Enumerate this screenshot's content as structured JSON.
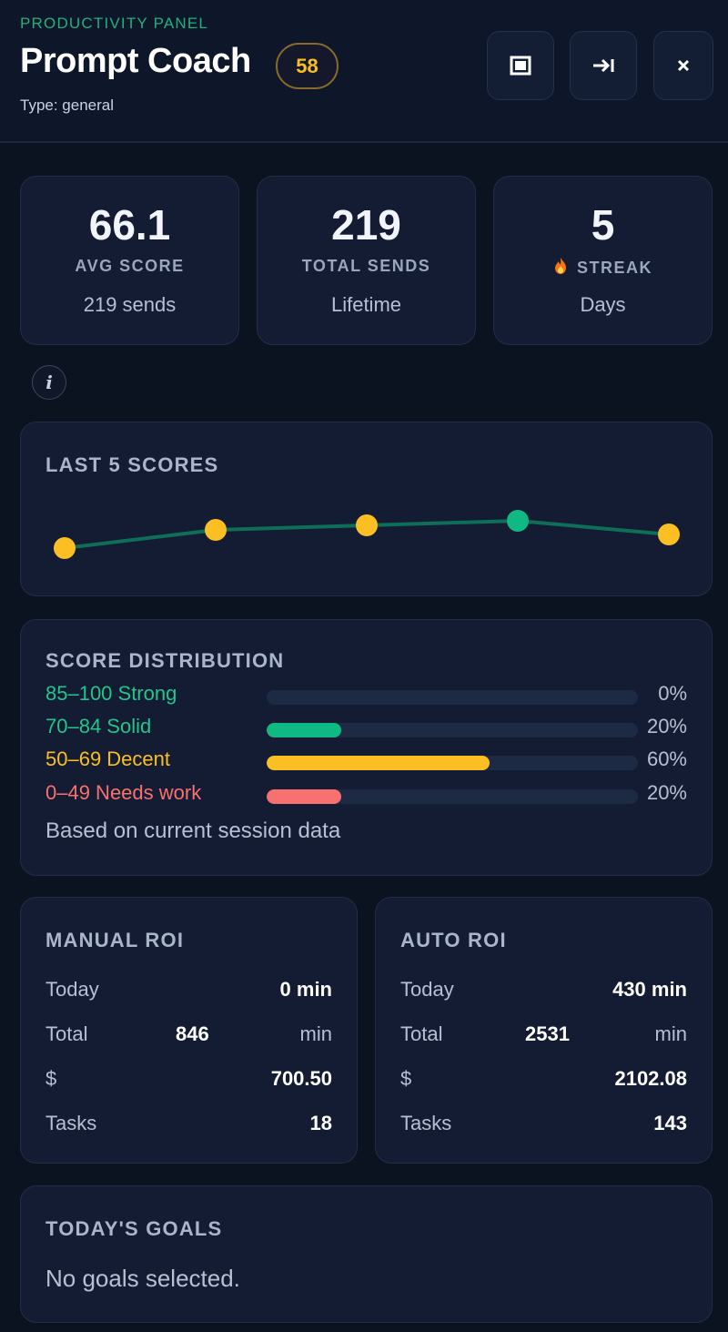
{
  "header": {
    "eyebrow": "PRODUCTIVITY PANEL",
    "title": "Prompt Coach",
    "badge": "58",
    "subtitle": "Type: general",
    "buttons": [
      {
        "icon": "square-icon",
        "glyph": "▣"
      },
      {
        "icon": "arrow-right-to-bar-icon",
        "glyph": "⇥"
      },
      {
        "icon": "close-icon",
        "glyph": "×"
      }
    ]
  },
  "stats": [
    {
      "value": "66.1",
      "label": "AVG SCORE",
      "sub": "219 sends"
    },
    {
      "value": "219",
      "label": "TOTAL SENDS",
      "sub": "Lifetime"
    },
    {
      "value": "5",
      "label": "STREAK",
      "sub": "Days",
      "icon": "flame-icon"
    }
  ],
  "info_icon": "i",
  "last_scores": {
    "title": "LAST 5 SCORES",
    "chart_data": {
      "type": "line",
      "x": [
        1,
        2,
        3,
        4,
        5
      ],
      "values": [
        62,
        66,
        67,
        68,
        65
      ],
      "point_colors": [
        "#fbbf24",
        "#fbbf24",
        "#fbbf24",
        "#10b981",
        "#fbbf24"
      ],
      "line_color": "#0f6e57"
    }
  },
  "distribution": {
    "title": "SCORE DISTRIBUTION",
    "rows": [
      {
        "label": "85–100 Strong",
        "pct": "0%",
        "value": 0,
        "color": "#22c58b"
      },
      {
        "label": "70–84 Solid",
        "pct": "20%",
        "value": 0.2,
        "color": "#10b981"
      },
      {
        "label": "50–69 Decent",
        "pct": "60%",
        "value": 0.6,
        "color": "#fbbf24"
      },
      {
        "label": "0–49 Needs work",
        "pct": "20%",
        "value": 0.2,
        "color": "#f87171"
      }
    ],
    "note": "Based on current session data"
  },
  "manual_roi": {
    "title": "MANUAL ROI",
    "today_label": "Today",
    "today_value": "0 min",
    "total_label": "Total",
    "total_value": "846",
    "total_unit": "min",
    "dollar_label": "$",
    "dollar_value": "700.50",
    "tasks_label": "Tasks",
    "tasks_value": "18"
  },
  "auto_roi": {
    "title": "AUTO ROI",
    "today_label": "Today",
    "today_value": "430 min",
    "total_label": "Total",
    "total_value": "2531",
    "total_unit": "min",
    "dollar_label": "$",
    "dollar_value": "2102.08",
    "tasks_label": "Tasks",
    "tasks_value": "143"
  },
  "goals": {
    "title": "TODAY'S GOALS",
    "empty": "No goals selected."
  }
}
